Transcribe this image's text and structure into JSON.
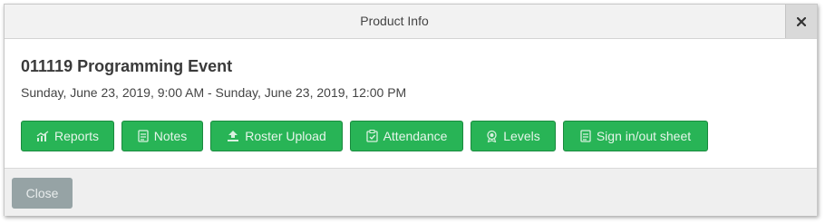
{
  "dialog": {
    "title": "Product Info",
    "close_icon": "close-icon"
  },
  "event": {
    "name": "011119 Programming Event",
    "date_range": "Sunday, June 23, 2019, 9:00 AM - Sunday, June 23, 2019, 12:00 PM"
  },
  "actions": [
    {
      "label": "Reports",
      "icon": "chart-icon"
    },
    {
      "label": "Notes",
      "icon": "notes-icon"
    },
    {
      "label": "Roster Upload",
      "icon": "upload-icon"
    },
    {
      "label": "Attendance",
      "icon": "clipboard-check-icon"
    },
    {
      "label": "Levels",
      "icon": "award-icon"
    },
    {
      "label": "Sign in/out sheet",
      "icon": "document-icon"
    }
  ],
  "footer": {
    "close_label": "Close"
  },
  "colors": {
    "button_green": "#28b456",
    "button_border": "#1a8a3e",
    "close_button_gray": "#96a3a5"
  }
}
